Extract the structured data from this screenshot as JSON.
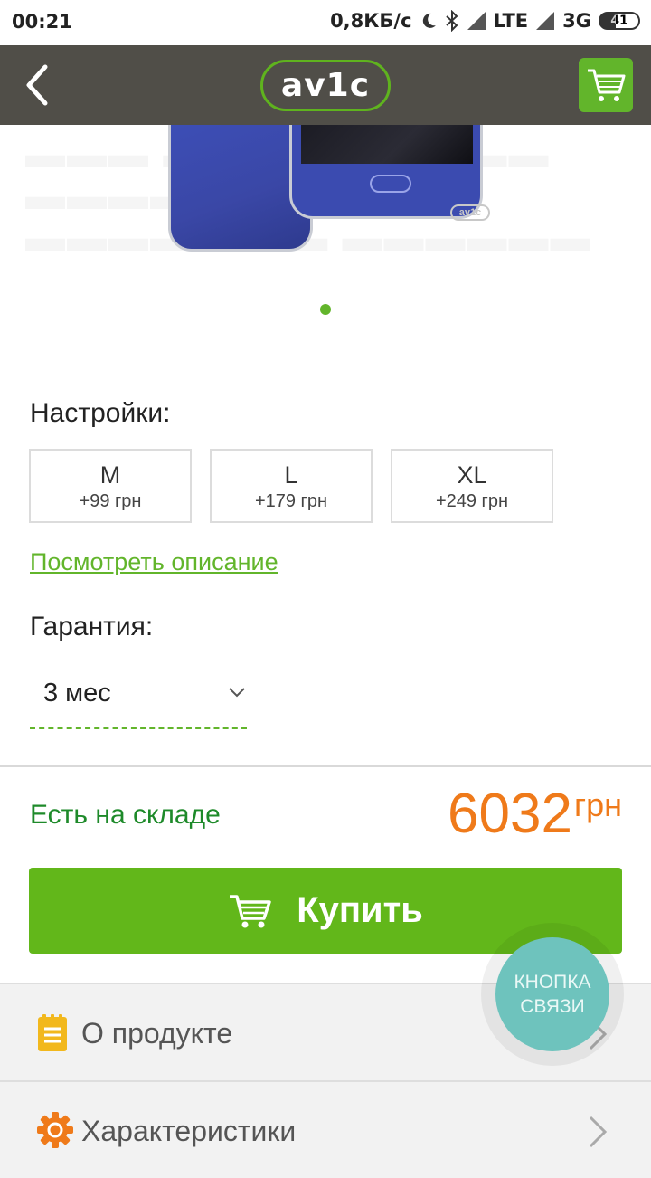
{
  "status_bar": {
    "time": "00:21",
    "network_speed": "0,8КБ/с",
    "lte_label": "LTE",
    "threeg_label": "3G",
    "battery": "41"
  },
  "header": {
    "logo_text": "av1c",
    "accent_color": "#62b52b"
  },
  "gallery": {
    "watermark": "av1c",
    "slide_count": 1,
    "active_slide": 1
  },
  "settings": {
    "label": "Настройки:",
    "options": [
      {
        "size": "M",
        "price": "+99 грн"
      },
      {
        "size": "L",
        "price": "+179 грн"
      },
      {
        "size": "XL",
        "price": "+249 грн"
      }
    ]
  },
  "description_link": "Посмотреть описание",
  "warranty": {
    "label": "Гарантия:",
    "selected": "3 мес"
  },
  "stock_status": "Есть на складе",
  "price": {
    "value": "6032",
    "currency": "грн",
    "color": "#ef7a1a"
  },
  "buy_button": {
    "label": "Купить"
  },
  "sections": [
    {
      "label": "О продукте",
      "icon": "document-icon"
    },
    {
      "label": "Характеристики",
      "icon": "gear-icon"
    }
  ],
  "contact_button": {
    "line1": "КНОПКА",
    "line2": "СВЯЗИ"
  }
}
